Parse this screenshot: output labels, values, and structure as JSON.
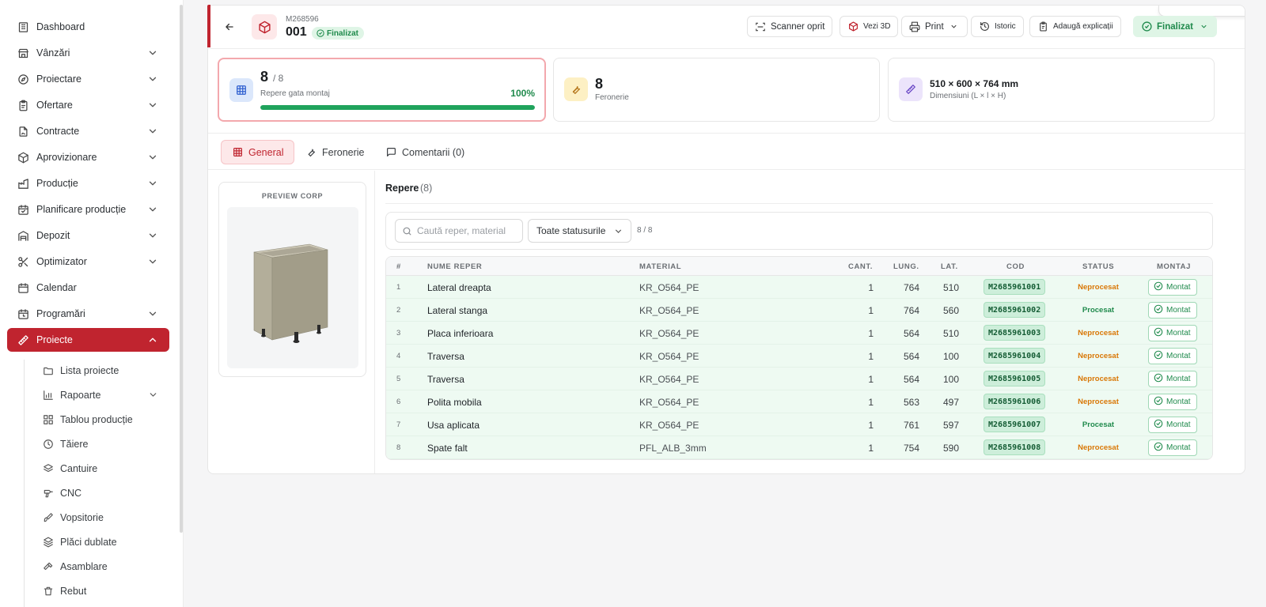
{
  "sidebar": {
    "items": [
      {
        "label": "Dashboard",
        "icon": "building-icon",
        "chevron": false
      },
      {
        "label": "Vânzări",
        "icon": "store-icon",
        "chevron": true
      },
      {
        "label": "Proiectare",
        "icon": "compass-icon",
        "chevron": true
      },
      {
        "label": "Ofertare",
        "icon": "clipboard-icon",
        "chevron": true
      },
      {
        "label": "Contracte",
        "icon": "contract-icon",
        "chevron": true
      },
      {
        "label": "Aprovizionare",
        "icon": "package-icon",
        "chevron": true
      },
      {
        "label": "Producție",
        "icon": "factory-icon",
        "chevron": true
      },
      {
        "label": "Planificare producție",
        "icon": "calendar-check-icon",
        "chevron": true
      },
      {
        "label": "Depozit",
        "icon": "warehouse-icon",
        "chevron": true
      },
      {
        "label": "Optimizator",
        "icon": "scissors-icon",
        "chevron": true
      },
      {
        "label": "Calendar",
        "icon": "calendar-icon",
        "chevron": false
      },
      {
        "label": "Programări",
        "icon": "calendar-clock-icon",
        "chevron": true
      },
      {
        "label": "Proiecte",
        "icon": "ruler-icon",
        "chevron": true,
        "active": true
      }
    ],
    "subitems": [
      {
        "label": "Lista proiecte",
        "icon": "folder-icon",
        "chevron": false
      },
      {
        "label": "Rapoarte",
        "icon": "bar-chart-icon",
        "chevron": true
      },
      {
        "label": "Tablou producție",
        "icon": "layout-grid-icon",
        "chevron": false
      },
      {
        "label": "Tăiere",
        "icon": "circle-clock-icon",
        "chevron": false
      },
      {
        "label": "Cantuire",
        "icon": "layers-icon",
        "chevron": false
      },
      {
        "label": "CNC",
        "icon": "drill-icon",
        "chevron": false
      },
      {
        "label": "Vopsitorie",
        "icon": "brush-icon",
        "chevron": false
      },
      {
        "label": "Plăci dublate",
        "icon": "layers-stack-icon",
        "chevron": false
      },
      {
        "label": "Asamblare",
        "icon": "hammer-icon",
        "chevron": false
      },
      {
        "label": "Rebut",
        "icon": "trash-icon",
        "chevron": false
      }
    ]
  },
  "header": {
    "code": "M268596",
    "number": "001",
    "status": "Finalizat",
    "buttons": {
      "scanner": "Scanner oprit",
      "view3d": "Vezi 3D",
      "print": "Print",
      "history": "Istoric",
      "explain": "Adaugă explicații",
      "final": "Finalizat"
    }
  },
  "stats": {
    "ready_count": "8",
    "ready_total": "/ 8",
    "ready_label": "Repere gata montaj",
    "ready_percent_text": "100%",
    "ready_fraction": 1.0,
    "hardware_count": "8",
    "hardware_label": "Feronerie",
    "dimensions": "510 × 600 × 764 mm",
    "dimensions_label": "Dimensiuni (L × l × H)"
  },
  "tabs": {
    "general": "General",
    "hardware": "Feronerie",
    "comments": "Comentarii (0)"
  },
  "preview": {
    "title": "PREVIEW CORP",
    "colors": {
      "panel_front": "#b3ae9a",
      "panel_side": "#9e9986",
      "panel_top": "#cfcab8",
      "inner": "#8f8b7a"
    }
  },
  "parts": {
    "title": "Repere",
    "count": "(8)",
    "search_placeholder": "Caută reper, material",
    "filter": "Toate statusurile",
    "match": "8 / 8",
    "columns": [
      "#",
      "NUME REPER",
      "MATERIAL",
      "CANT.",
      "LUNG.",
      "LAT.",
      "COD",
      "STATUS",
      "MONTAJ"
    ],
    "rows": [
      {
        "idx": "1",
        "name": "Lateral dreapta",
        "material": "KR_O564_PE",
        "qty": "1",
        "len": "764",
        "wid": "510",
        "code": "M2685961001",
        "status": "Neprocesat",
        "montaj": "Montat"
      },
      {
        "idx": "2",
        "name": "Lateral stanga",
        "material": "KR_O564_PE",
        "qty": "1",
        "len": "764",
        "wid": "560",
        "code": "M2685961002",
        "status": "Procesat",
        "montaj": "Montat"
      },
      {
        "idx": "3",
        "name": "Placa inferioara",
        "material": "KR_O564_PE",
        "qty": "1",
        "len": "564",
        "wid": "510",
        "code": "M2685961003",
        "status": "Neprocesat",
        "montaj": "Montat"
      },
      {
        "idx": "4",
        "name": "Traversa",
        "material": "KR_O564_PE",
        "qty": "1",
        "len": "564",
        "wid": "100",
        "code": "M2685961004",
        "status": "Neprocesat",
        "montaj": "Montat"
      },
      {
        "idx": "5",
        "name": "Traversa",
        "material": "KR_O564_PE",
        "qty": "1",
        "len": "564",
        "wid": "100",
        "code": "M2685961005",
        "status": "Neprocesat",
        "montaj": "Montat"
      },
      {
        "idx": "6",
        "name": "Polita mobila",
        "material": "KR_O564_PE",
        "qty": "1",
        "len": "563",
        "wid": "497",
        "code": "M2685961006",
        "status": "Neprocesat",
        "montaj": "Montat"
      },
      {
        "idx": "7",
        "name": "Usa aplicata",
        "material": "KR_O564_PE",
        "qty": "1",
        "len": "761",
        "wid": "597",
        "code": "M2685961007",
        "status": "Procesat",
        "montaj": "Montat"
      },
      {
        "idx": "8",
        "name": "Spate falt",
        "material": "PFL_ALB_3mm",
        "qty": "1",
        "len": "754",
        "wid": "590",
        "code": "M2685961008",
        "status": "Neprocesat",
        "montaj": "Montat"
      }
    ]
  },
  "colors": {
    "accent": "#c0242f",
    "success": "#1f8a4c",
    "warning": "#d97706",
    "row_bg": "#eefaf2"
  }
}
